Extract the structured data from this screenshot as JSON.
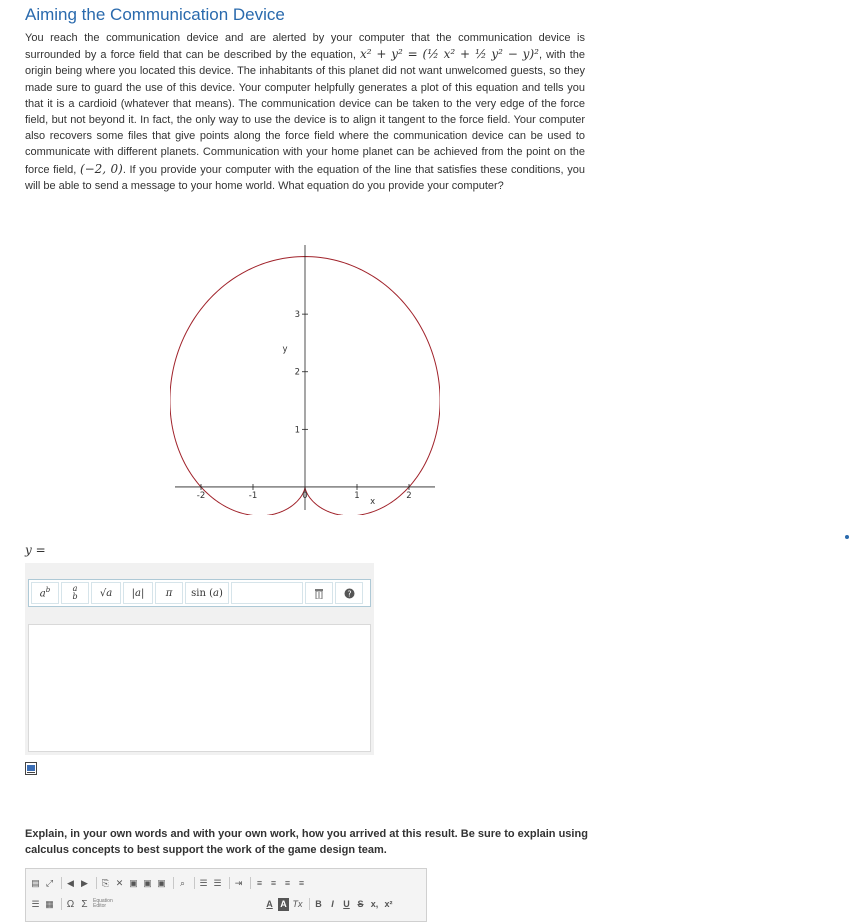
{
  "title": "Aiming the Communication Device",
  "problem": {
    "part1": "You reach the communication device and are alerted by your computer that the communication device is surrounded by a force field that can be described by the equation, ",
    "equation": "x² + y² = (½ x² + ½ y² − y)²",
    "part2": ", with the origin being where you located this device. The inhabitants of this planet did not want unwelcomed guests, so they made sure to guard the use of this device. Your computer helpfully generates a plot of this equation and tells you that it is a cardioid (whatever that means). The communication device can be taken to the very edge of the force field, but not beyond it. In fact, the only way to use the device is to align it tangent to the force field. Your computer also recovers some files that give points along the force field where the communication device can be used to communicate with different planets. Communication with your home planet can be achieved from the point on the force field, ",
    "point": "(−2, 0)",
    "part3": ". If you provide your computer with the equation of the line that satisfies these conditions, you will be able to send a message to your home world. What equation do you provide your computer?"
  },
  "chart_data": {
    "type": "line",
    "curve": "cardioid",
    "equation": "x^2 + y^2 = (1/2 x^2 + 1/2 y^2 - y)^2",
    "x_ticks": [
      "-2",
      "-1",
      "0",
      "1",
      "2"
    ],
    "y_ticks": [
      "1",
      "2",
      "3"
    ],
    "xlabel": "x",
    "ylabel": "y",
    "xlim": [
      -2.5,
      2.5
    ],
    "ylim": [
      -0.4,
      4.2
    ],
    "curve_color": "#a0222a"
  },
  "answer": {
    "label": "y =",
    "toolbar": [
      "a^b",
      "a/b",
      "√a",
      "|a|",
      "π",
      "sin(a)",
      "trash",
      "help"
    ]
  },
  "explain": {
    "prompt": "Explain, in your own words and with your own work, how you arrived at this result. Be sure to explain using calculus concepts to best support the work of the game design team."
  },
  "rte": {
    "row2_label": "Equation Editor",
    "font_color": "A",
    "bg_color": "A",
    "clear_format": "Tx",
    "bold": "B",
    "italic": "I",
    "underline": "U",
    "strike": "S",
    "subscript": "x,",
    "superscript": "x²"
  },
  "colors": {
    "accent": "#2a6aad",
    "curve": "#a0222a"
  }
}
